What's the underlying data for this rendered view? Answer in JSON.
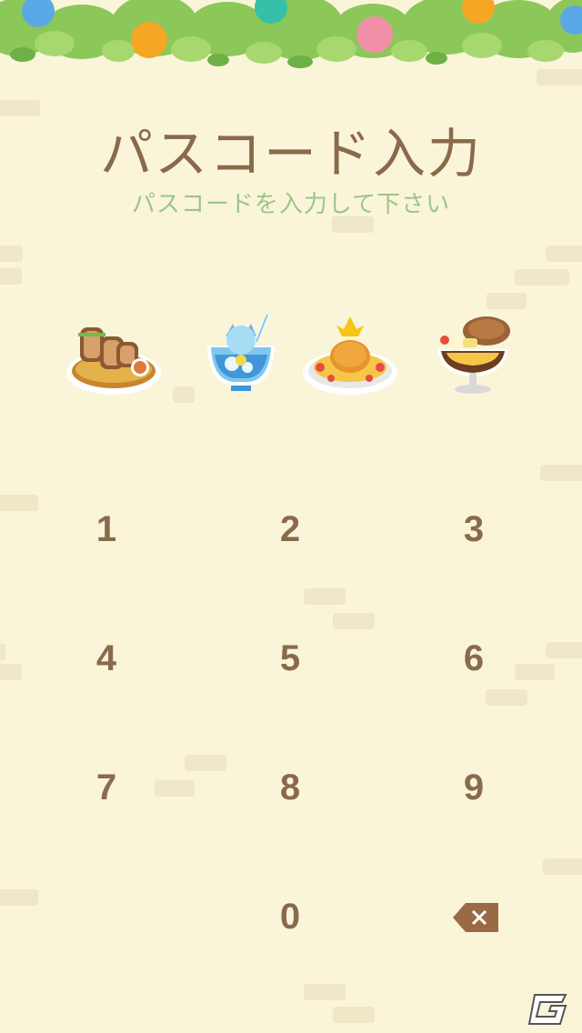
{
  "title": "パスコード入力",
  "subtitle": "パスコードを入力して下さい",
  "passcode_slots": [
    {
      "icon": "sandwich-platter-icon"
    },
    {
      "icon": "blue-drink-icon"
    },
    {
      "icon": "omelette-rice-icon"
    },
    {
      "icon": "chocolate-parfait-icon"
    }
  ],
  "keypad": {
    "k1": "1",
    "k2": "2",
    "k3": "3",
    "k4": "4",
    "k5": "5",
    "k6": "6",
    "k7": "7",
    "k8": "8",
    "k9": "9",
    "k0": "0"
  },
  "delete_icon": "backspace-icon",
  "watermark_icon": "g-logo-icon",
  "colors": {
    "background": "#faf5d9",
    "text_brown": "#8a6a4c",
    "subtitle_green": "#9cc58a"
  }
}
